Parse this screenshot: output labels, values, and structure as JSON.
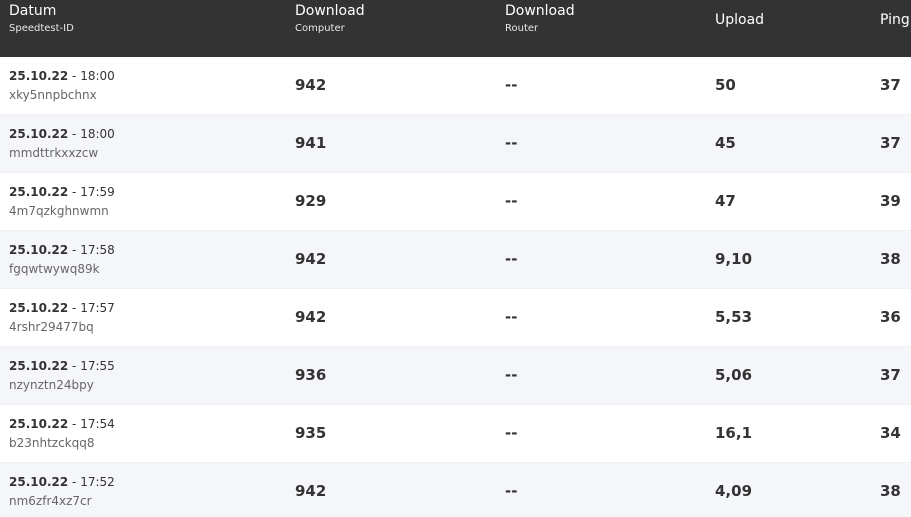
{
  "header": {
    "date_label": "Datum",
    "date_sub": "Speedtest-ID",
    "download_computer_label": "Download",
    "download_computer_sub": "Computer",
    "download_router_label": "Download",
    "download_router_sub": "Router",
    "upload_label": "Upload",
    "ping_label": "Ping"
  },
  "rows": [
    {
      "date": "25.10.22",
      "time": "- 18:00",
      "id": "xky5nnpbchnx",
      "download_computer": "942",
      "download_router": "--",
      "upload": "50",
      "ping": "37"
    },
    {
      "date": "25.10.22",
      "time": "- 18:00",
      "id": "mmdttrkxxzcw",
      "download_computer": "941",
      "download_router": "--",
      "upload": "45",
      "ping": "37"
    },
    {
      "date": "25.10.22",
      "time": "- 17:59",
      "id": "4m7qzkghnwmn",
      "download_computer": "929",
      "download_router": "--",
      "upload": "47",
      "ping": "39"
    },
    {
      "date": "25.10.22",
      "time": "- 17:58",
      "id": "fgqwtwywq89k",
      "download_computer": "942",
      "download_router": "--",
      "upload": "9,10",
      "ping": "38"
    },
    {
      "date": "25.10.22",
      "time": "- 17:57",
      "id": "4rshr29477bq",
      "download_computer": "942",
      "download_router": "--",
      "upload": "5,53",
      "ping": "36"
    },
    {
      "date": "25.10.22",
      "time": "- 17:55",
      "id": "nzynztn24bpy",
      "download_computer": "936",
      "download_router": "--",
      "upload": "5,06",
      "ping": "37"
    },
    {
      "date": "25.10.22",
      "time": "- 17:54",
      "id": "b23nhtzckqq8",
      "download_computer": "935",
      "download_router": "--",
      "upload": "16,1",
      "ping": "34"
    },
    {
      "date": "25.10.22",
      "time": "- 17:52",
      "id": "nm6zfr4xz7cr",
      "download_computer": "942",
      "download_router": "--",
      "upload": "4,09",
      "ping": "38"
    }
  ]
}
